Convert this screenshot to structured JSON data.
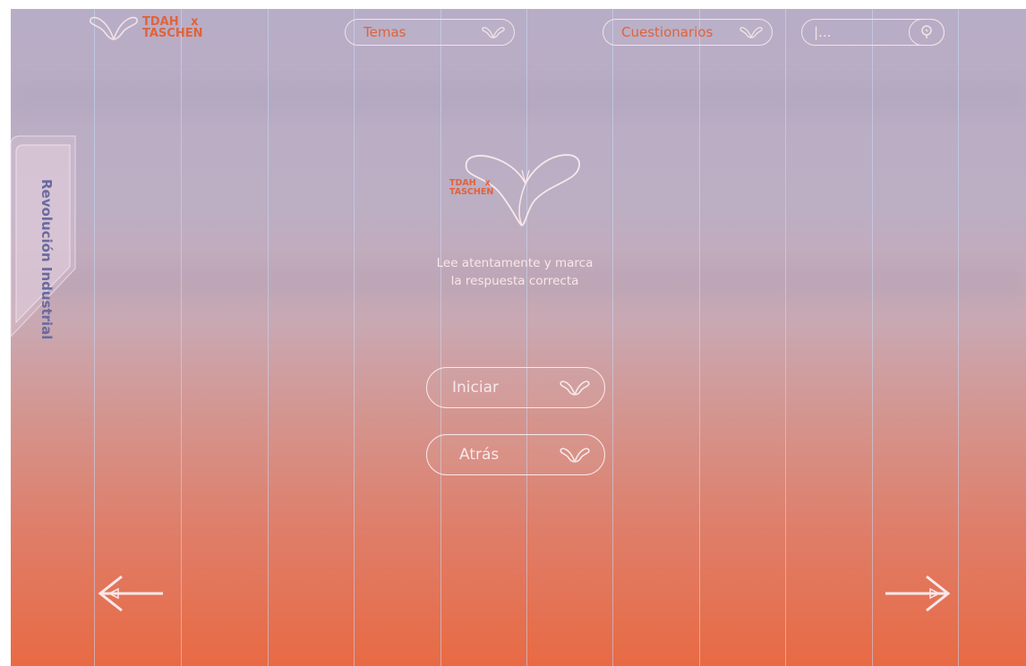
{
  "header": {
    "logo": {
      "line1": "TDAH   x",
      "line2": "TASCHEN"
    },
    "nav": {
      "temas_label": "Temas",
      "cuestionarios_label": "Cuestionarios"
    },
    "search": {
      "value": "|..."
    }
  },
  "side_tab": {
    "label": "Revolución Industrial"
  },
  "center": {
    "logo_line1": "TDAH   x",
    "logo_line2": "TASCHEN",
    "instructions_line1": "Lee atentamente y marca",
    "instructions_line2": "la respuesta correcta"
  },
  "buttons": {
    "start_label": "Iniciar",
    "back_label": "Atrás"
  },
  "colors": {
    "accent": "#e0633b",
    "outline": "#f3e3e6",
    "tab_text": "#6a6aa0",
    "gradient_top": "#b8adc6",
    "gradient_bottom": "#e86a44"
  }
}
